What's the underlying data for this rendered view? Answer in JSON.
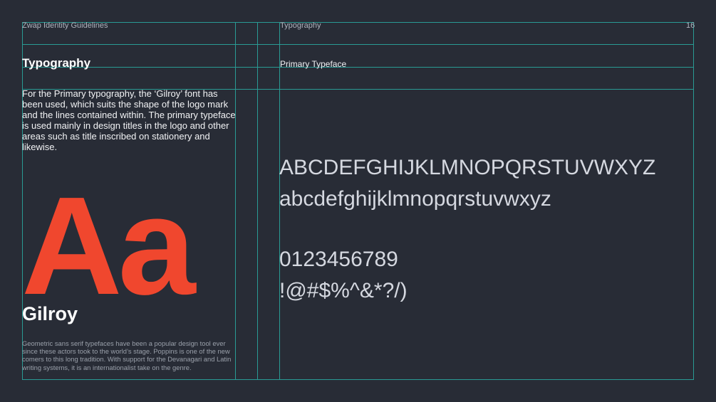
{
  "header": {
    "doc_title": "Zwap Identity Guidelines",
    "section_label": "Typography",
    "page_number": "16"
  },
  "left": {
    "title": "Typography",
    "intro": "For the Primary typography, the ‘Gilroy’ font has been used, which suits the shape of the logo mark and the lines contained within. The primary typeface is used mainly in design titles in the logo and other areas such as title inscribed on stationery and likewise.",
    "specimen": "Aa",
    "font_name": "Gilroy",
    "description": "Geometric sans serif typefaces have been a popular design tool ever since these actors took to the world’s stage. Poppins is one of the new comers to this long tradition. With support for the Devanagari and Latin writing systems, it is an internationalist take on the genre."
  },
  "right": {
    "title": "Primary Typeface",
    "uppercase": "ABCDEFGHIJKLMNOPQRSTUVWXYZ",
    "lowercase": "abcdefghijklmnopqrstuvwxyz",
    "numerals": "0123456789",
    "symbols": "!@#$%^&*?/)"
  },
  "colors": {
    "background": "#282c36",
    "grid": "#2a9b94",
    "accent": "#f0472e"
  }
}
